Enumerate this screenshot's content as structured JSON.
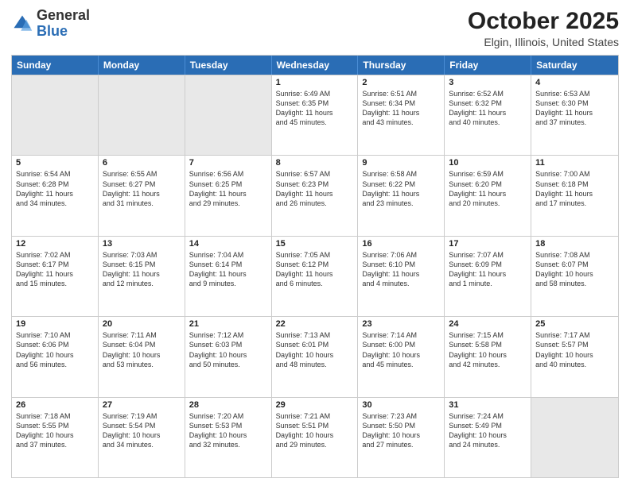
{
  "header": {
    "logo_general": "General",
    "logo_blue": "Blue",
    "title": "October 2025",
    "location": "Elgin, Illinois, United States"
  },
  "days_of_week": [
    "Sunday",
    "Monday",
    "Tuesday",
    "Wednesday",
    "Thursday",
    "Friday",
    "Saturday"
  ],
  "weeks": [
    [
      {
        "day": "",
        "info": "",
        "shaded": true
      },
      {
        "day": "",
        "info": "",
        "shaded": true
      },
      {
        "day": "",
        "info": "",
        "shaded": true
      },
      {
        "day": "1",
        "info": "Sunrise: 6:49 AM\nSunset: 6:35 PM\nDaylight: 11 hours\nand 45 minutes."
      },
      {
        "day": "2",
        "info": "Sunrise: 6:51 AM\nSunset: 6:34 PM\nDaylight: 11 hours\nand 43 minutes."
      },
      {
        "day": "3",
        "info": "Sunrise: 6:52 AM\nSunset: 6:32 PM\nDaylight: 11 hours\nand 40 minutes."
      },
      {
        "day": "4",
        "info": "Sunrise: 6:53 AM\nSunset: 6:30 PM\nDaylight: 11 hours\nand 37 minutes."
      }
    ],
    [
      {
        "day": "5",
        "info": "Sunrise: 6:54 AM\nSunset: 6:28 PM\nDaylight: 11 hours\nand 34 minutes."
      },
      {
        "day": "6",
        "info": "Sunrise: 6:55 AM\nSunset: 6:27 PM\nDaylight: 11 hours\nand 31 minutes."
      },
      {
        "day": "7",
        "info": "Sunrise: 6:56 AM\nSunset: 6:25 PM\nDaylight: 11 hours\nand 29 minutes."
      },
      {
        "day": "8",
        "info": "Sunrise: 6:57 AM\nSunset: 6:23 PM\nDaylight: 11 hours\nand 26 minutes."
      },
      {
        "day": "9",
        "info": "Sunrise: 6:58 AM\nSunset: 6:22 PM\nDaylight: 11 hours\nand 23 minutes."
      },
      {
        "day": "10",
        "info": "Sunrise: 6:59 AM\nSunset: 6:20 PM\nDaylight: 11 hours\nand 20 minutes."
      },
      {
        "day": "11",
        "info": "Sunrise: 7:00 AM\nSunset: 6:18 PM\nDaylight: 11 hours\nand 17 minutes."
      }
    ],
    [
      {
        "day": "12",
        "info": "Sunrise: 7:02 AM\nSunset: 6:17 PM\nDaylight: 11 hours\nand 15 minutes."
      },
      {
        "day": "13",
        "info": "Sunrise: 7:03 AM\nSunset: 6:15 PM\nDaylight: 11 hours\nand 12 minutes."
      },
      {
        "day": "14",
        "info": "Sunrise: 7:04 AM\nSunset: 6:14 PM\nDaylight: 11 hours\nand 9 minutes."
      },
      {
        "day": "15",
        "info": "Sunrise: 7:05 AM\nSunset: 6:12 PM\nDaylight: 11 hours\nand 6 minutes."
      },
      {
        "day": "16",
        "info": "Sunrise: 7:06 AM\nSunset: 6:10 PM\nDaylight: 11 hours\nand 4 minutes."
      },
      {
        "day": "17",
        "info": "Sunrise: 7:07 AM\nSunset: 6:09 PM\nDaylight: 11 hours\nand 1 minute."
      },
      {
        "day": "18",
        "info": "Sunrise: 7:08 AM\nSunset: 6:07 PM\nDaylight: 10 hours\nand 58 minutes."
      }
    ],
    [
      {
        "day": "19",
        "info": "Sunrise: 7:10 AM\nSunset: 6:06 PM\nDaylight: 10 hours\nand 56 minutes."
      },
      {
        "day": "20",
        "info": "Sunrise: 7:11 AM\nSunset: 6:04 PM\nDaylight: 10 hours\nand 53 minutes."
      },
      {
        "day": "21",
        "info": "Sunrise: 7:12 AM\nSunset: 6:03 PM\nDaylight: 10 hours\nand 50 minutes."
      },
      {
        "day": "22",
        "info": "Sunrise: 7:13 AM\nSunset: 6:01 PM\nDaylight: 10 hours\nand 48 minutes."
      },
      {
        "day": "23",
        "info": "Sunrise: 7:14 AM\nSunset: 6:00 PM\nDaylight: 10 hours\nand 45 minutes."
      },
      {
        "day": "24",
        "info": "Sunrise: 7:15 AM\nSunset: 5:58 PM\nDaylight: 10 hours\nand 42 minutes."
      },
      {
        "day": "25",
        "info": "Sunrise: 7:17 AM\nSunset: 5:57 PM\nDaylight: 10 hours\nand 40 minutes."
      }
    ],
    [
      {
        "day": "26",
        "info": "Sunrise: 7:18 AM\nSunset: 5:55 PM\nDaylight: 10 hours\nand 37 minutes."
      },
      {
        "day": "27",
        "info": "Sunrise: 7:19 AM\nSunset: 5:54 PM\nDaylight: 10 hours\nand 34 minutes."
      },
      {
        "day": "28",
        "info": "Sunrise: 7:20 AM\nSunset: 5:53 PM\nDaylight: 10 hours\nand 32 minutes."
      },
      {
        "day": "29",
        "info": "Sunrise: 7:21 AM\nSunset: 5:51 PM\nDaylight: 10 hours\nand 29 minutes."
      },
      {
        "day": "30",
        "info": "Sunrise: 7:23 AM\nSunset: 5:50 PM\nDaylight: 10 hours\nand 27 minutes."
      },
      {
        "day": "31",
        "info": "Sunrise: 7:24 AM\nSunset: 5:49 PM\nDaylight: 10 hours\nand 24 minutes."
      },
      {
        "day": "",
        "info": "",
        "shaded": true
      }
    ]
  ]
}
